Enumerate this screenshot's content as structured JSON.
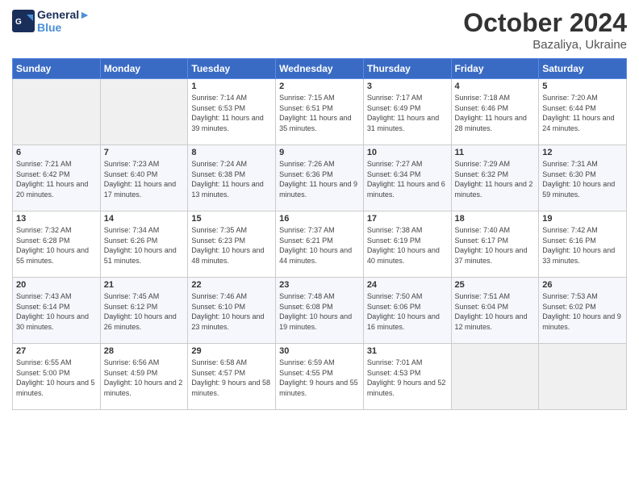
{
  "header": {
    "logo_line1": "General",
    "logo_line2": "Blue",
    "month": "October 2024",
    "location": "Bazaliya, Ukraine"
  },
  "days_of_week": [
    "Sunday",
    "Monday",
    "Tuesday",
    "Wednesday",
    "Thursday",
    "Friday",
    "Saturday"
  ],
  "weeks": [
    [
      {
        "num": "",
        "info": ""
      },
      {
        "num": "",
        "info": ""
      },
      {
        "num": "1",
        "info": "Sunrise: 7:14 AM\nSunset: 6:53 PM\nDaylight: 11 hours and 39 minutes."
      },
      {
        "num": "2",
        "info": "Sunrise: 7:15 AM\nSunset: 6:51 PM\nDaylight: 11 hours and 35 minutes."
      },
      {
        "num": "3",
        "info": "Sunrise: 7:17 AM\nSunset: 6:49 PM\nDaylight: 11 hours and 31 minutes."
      },
      {
        "num": "4",
        "info": "Sunrise: 7:18 AM\nSunset: 6:46 PM\nDaylight: 11 hours and 28 minutes."
      },
      {
        "num": "5",
        "info": "Sunrise: 7:20 AM\nSunset: 6:44 PM\nDaylight: 11 hours and 24 minutes."
      }
    ],
    [
      {
        "num": "6",
        "info": "Sunrise: 7:21 AM\nSunset: 6:42 PM\nDaylight: 11 hours and 20 minutes."
      },
      {
        "num": "7",
        "info": "Sunrise: 7:23 AM\nSunset: 6:40 PM\nDaylight: 11 hours and 17 minutes."
      },
      {
        "num": "8",
        "info": "Sunrise: 7:24 AM\nSunset: 6:38 PM\nDaylight: 11 hours and 13 minutes."
      },
      {
        "num": "9",
        "info": "Sunrise: 7:26 AM\nSunset: 6:36 PM\nDaylight: 11 hours and 9 minutes."
      },
      {
        "num": "10",
        "info": "Sunrise: 7:27 AM\nSunset: 6:34 PM\nDaylight: 11 hours and 6 minutes."
      },
      {
        "num": "11",
        "info": "Sunrise: 7:29 AM\nSunset: 6:32 PM\nDaylight: 11 hours and 2 minutes."
      },
      {
        "num": "12",
        "info": "Sunrise: 7:31 AM\nSunset: 6:30 PM\nDaylight: 10 hours and 59 minutes."
      }
    ],
    [
      {
        "num": "13",
        "info": "Sunrise: 7:32 AM\nSunset: 6:28 PM\nDaylight: 10 hours and 55 minutes."
      },
      {
        "num": "14",
        "info": "Sunrise: 7:34 AM\nSunset: 6:26 PM\nDaylight: 10 hours and 51 minutes."
      },
      {
        "num": "15",
        "info": "Sunrise: 7:35 AM\nSunset: 6:23 PM\nDaylight: 10 hours and 48 minutes."
      },
      {
        "num": "16",
        "info": "Sunrise: 7:37 AM\nSunset: 6:21 PM\nDaylight: 10 hours and 44 minutes."
      },
      {
        "num": "17",
        "info": "Sunrise: 7:38 AM\nSunset: 6:19 PM\nDaylight: 10 hours and 40 minutes."
      },
      {
        "num": "18",
        "info": "Sunrise: 7:40 AM\nSunset: 6:17 PM\nDaylight: 10 hours and 37 minutes."
      },
      {
        "num": "19",
        "info": "Sunrise: 7:42 AM\nSunset: 6:16 PM\nDaylight: 10 hours and 33 minutes."
      }
    ],
    [
      {
        "num": "20",
        "info": "Sunrise: 7:43 AM\nSunset: 6:14 PM\nDaylight: 10 hours and 30 minutes."
      },
      {
        "num": "21",
        "info": "Sunrise: 7:45 AM\nSunset: 6:12 PM\nDaylight: 10 hours and 26 minutes."
      },
      {
        "num": "22",
        "info": "Sunrise: 7:46 AM\nSunset: 6:10 PM\nDaylight: 10 hours and 23 minutes."
      },
      {
        "num": "23",
        "info": "Sunrise: 7:48 AM\nSunset: 6:08 PM\nDaylight: 10 hours and 19 minutes."
      },
      {
        "num": "24",
        "info": "Sunrise: 7:50 AM\nSunset: 6:06 PM\nDaylight: 10 hours and 16 minutes."
      },
      {
        "num": "25",
        "info": "Sunrise: 7:51 AM\nSunset: 6:04 PM\nDaylight: 10 hours and 12 minutes."
      },
      {
        "num": "26",
        "info": "Sunrise: 7:53 AM\nSunset: 6:02 PM\nDaylight: 10 hours and 9 minutes."
      }
    ],
    [
      {
        "num": "27",
        "info": "Sunrise: 6:55 AM\nSunset: 5:00 PM\nDaylight: 10 hours and 5 minutes."
      },
      {
        "num": "28",
        "info": "Sunrise: 6:56 AM\nSunset: 4:59 PM\nDaylight: 10 hours and 2 minutes."
      },
      {
        "num": "29",
        "info": "Sunrise: 6:58 AM\nSunset: 4:57 PM\nDaylight: 9 hours and 58 minutes."
      },
      {
        "num": "30",
        "info": "Sunrise: 6:59 AM\nSunset: 4:55 PM\nDaylight: 9 hours and 55 minutes."
      },
      {
        "num": "31",
        "info": "Sunrise: 7:01 AM\nSunset: 4:53 PM\nDaylight: 9 hours and 52 minutes."
      },
      {
        "num": "",
        "info": ""
      },
      {
        "num": "",
        "info": ""
      }
    ]
  ]
}
